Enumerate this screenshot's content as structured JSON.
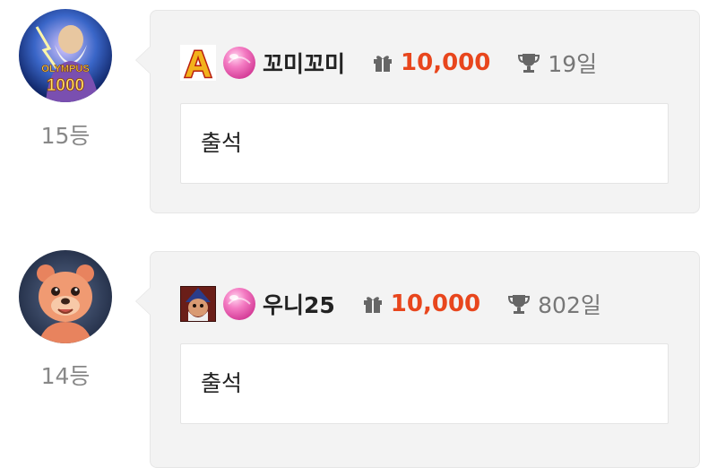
{
  "entries": [
    {
      "rank": "15등",
      "nickname": "꼬미꼬미",
      "points": "10,000",
      "days": "19일",
      "message": "출석",
      "avatar_icon": "olympus-1000-game-avatar",
      "avatar_text": [
        "OLYMPUS",
        "1000"
      ],
      "badge_icon": "letter-a-badge-icon",
      "badge_letter": "A"
    },
    {
      "rank": "14등",
      "nickname": "우니25",
      "points": "10,000",
      "days": "802일",
      "message": "출석",
      "avatar_icon": "bear-character-avatar",
      "badge_icon": "wizard-portrait-badge-icon"
    }
  ],
  "colors": {
    "points": "#e8461d",
    "card_bg": "#f3f3f3",
    "rank_text": "#888888",
    "candy": "#f05fb0"
  },
  "icons": {
    "level": "pink-candy-icon",
    "points": "gift-icon",
    "days": "trophy-icon"
  }
}
